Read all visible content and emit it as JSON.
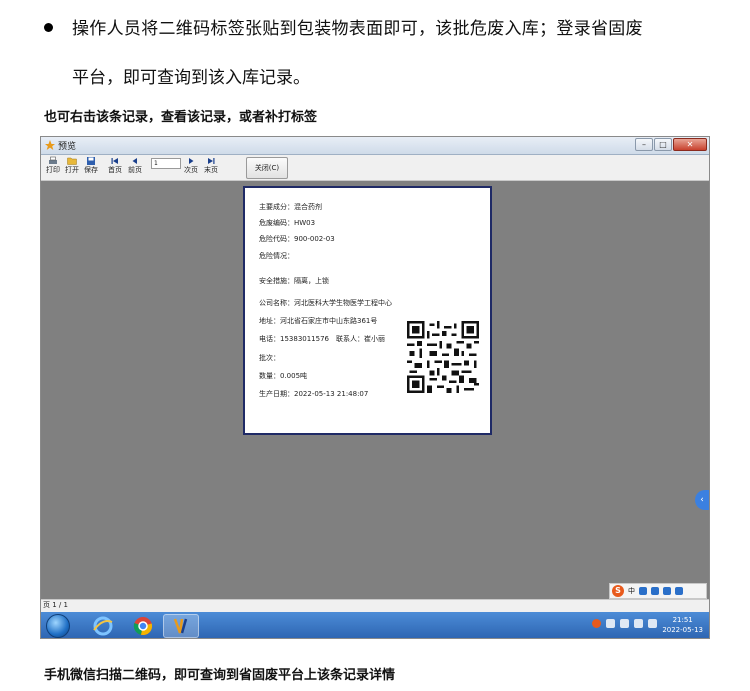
{
  "doc": {
    "bullet_text": "操作人员将二维码标签张贴到包装物表面即可，该批危废入库；登录省固废",
    "bullet_text_cont": "平台，即可查询到该入库记录。",
    "caption_top": "也可右击该条记录，查看该记录，或者补打标签",
    "caption_bottom": "手机微信扫描二维码，即可查询到省固废平台上该条记录详情"
  },
  "window": {
    "title": "预览",
    "minimize": "–",
    "restore": "□",
    "close": "✕"
  },
  "toolbar": {
    "print": "打印",
    "open": "打开",
    "save": "保存",
    "first": "首页",
    "prev": "前页",
    "page_value": "1",
    "next": "次页",
    "last": "末页",
    "close_button": "关闭(C)"
  },
  "label": {
    "main_component": "主要成分：混合药剂",
    "waste_code": "危废编码：HW03",
    "hazard_code": "危险代码：900-002-03",
    "hazard_status": "危险情况：",
    "safety_measures": "安全措施：隔离，上锁",
    "company": "公司名称：河北医科大学生物医学工程中心",
    "address": "地址：河北省石家庄市中山东路361号",
    "phone_contact": "电话：15383011576　联系人：崔小丽",
    "batch": "批次：",
    "quantity": "数量：0.005吨",
    "production_date": "生产日期：2022-05-13 21:48:07"
  },
  "status": {
    "page_indicator": "页 1 / 1"
  },
  "taskbar": {
    "clock_time": "21:51",
    "clock_date": "2022-05-13"
  },
  "ime": {
    "lang": "中"
  },
  "colors": {
    "label_border": "#1f2a66",
    "canvas": "#808080",
    "taskbar": "#2c63b0",
    "sogou": "#e85a1c",
    "side_tab": "#3b80e0"
  },
  "icons": {
    "bullet": "bullet-dot",
    "app": "preview-app-icon",
    "side_tab": "chevron-left-icon"
  }
}
